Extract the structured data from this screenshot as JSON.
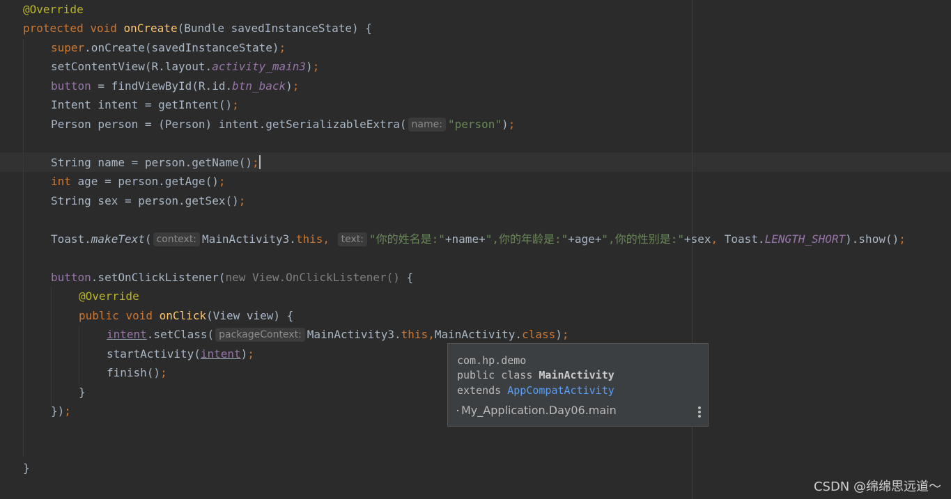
{
  "code": {
    "l1": {
      "ann": "@Override"
    },
    "l2": {
      "kw1": "protected",
      "kw2": "void",
      "method": "onCreate",
      "rest": "(Bundle savedInstanceState) {"
    },
    "l3": {
      "kw": "super",
      "rest": ".onCreate(savedInstanceState)",
      "semi": ";"
    },
    "l4": {
      "a": "setContentView(R.layout.",
      "field": "activity_main3",
      "b": ")",
      "semi": ";"
    },
    "l5": {
      "field": "button",
      "a": " = findViewById(R.id.",
      "field2": "btn_back",
      "b": ")",
      "semi": ";"
    },
    "l6": {
      "a": "Intent intent = getIntent()",
      "semi": ";"
    },
    "l7": {
      "a": "Person person = (Person) intent.getSerializableExtra(",
      "hint": "name:",
      "str": "\"person\"",
      "b": ")",
      "semi": ";"
    },
    "l8": {
      "a": "String name = person.getName()",
      "semi": ";"
    },
    "l9": {
      "kw": "int",
      "a": " age = person.getAge()",
      "semi": ";"
    },
    "l10": {
      "a": "String sex = person.getSex()",
      "semi": ";"
    },
    "l11": {
      "a": "Toast.",
      "method": "makeText",
      "b": "(",
      "hint1": "context:",
      "c": "MainActivity3.",
      "kw_this": "this",
      "comma": ", ",
      "hint2": "text:",
      "str1": "\"你的姓名是:\"",
      "d": "+name+",
      "str2": "\",你的年龄是:\"",
      "e": "+age+",
      "str3": "\",你的性别是:\"",
      "f": "+sex",
      "comma2": ", ",
      "g": "Toast.",
      "const": "LENGTH_SHORT",
      "h": ").show()",
      "semi": ";"
    },
    "l12": {
      "field": "button",
      "a": ".setOnClickListener(",
      "grey": "new View.OnClickListener()",
      "b": " {"
    },
    "l13": {
      "ann": "@Override"
    },
    "l14": {
      "kw1": "public",
      "kw2": "void",
      "method": "onClick",
      "rest": "(View view) {"
    },
    "l15": {
      "var": "intent",
      "a": ".setClass(",
      "hint": "packageContext:",
      "b": "MainActivity3.",
      "kw_this": "this",
      "comma": ",",
      "c": "MainActivity.",
      "kw_class": "class",
      "d": ")",
      "semi": ";"
    },
    "l16": {
      "a": "startActivity(",
      "var": "intent",
      "b": ")",
      "semi": ";"
    },
    "l17": {
      "a": "finish()",
      "semi": ";"
    },
    "l18": {
      "a": "}"
    },
    "l19": {
      "a": "})",
      "semi": ";"
    },
    "l20": {
      "a": "}"
    }
  },
  "popup": {
    "package": "com.hp.demo",
    "decl_prefix": "public class ",
    "class_name": "MainActivity",
    "extends_prefix": "extends ",
    "superclass": "AppCompatActivity",
    "module": "My_Application.Day06.main",
    "menu_icon": "more-vertical-icon"
  },
  "watermark": "CSDN @绵绵思远道～",
  "colors": {
    "background": "#2b2b2b",
    "keyword": "#cc7832",
    "annotation": "#bbb529",
    "method_decl": "#ffc66d",
    "field": "#9876aa",
    "string": "#6a8759",
    "default_text": "#a9b7c6",
    "link": "#589df6"
  }
}
